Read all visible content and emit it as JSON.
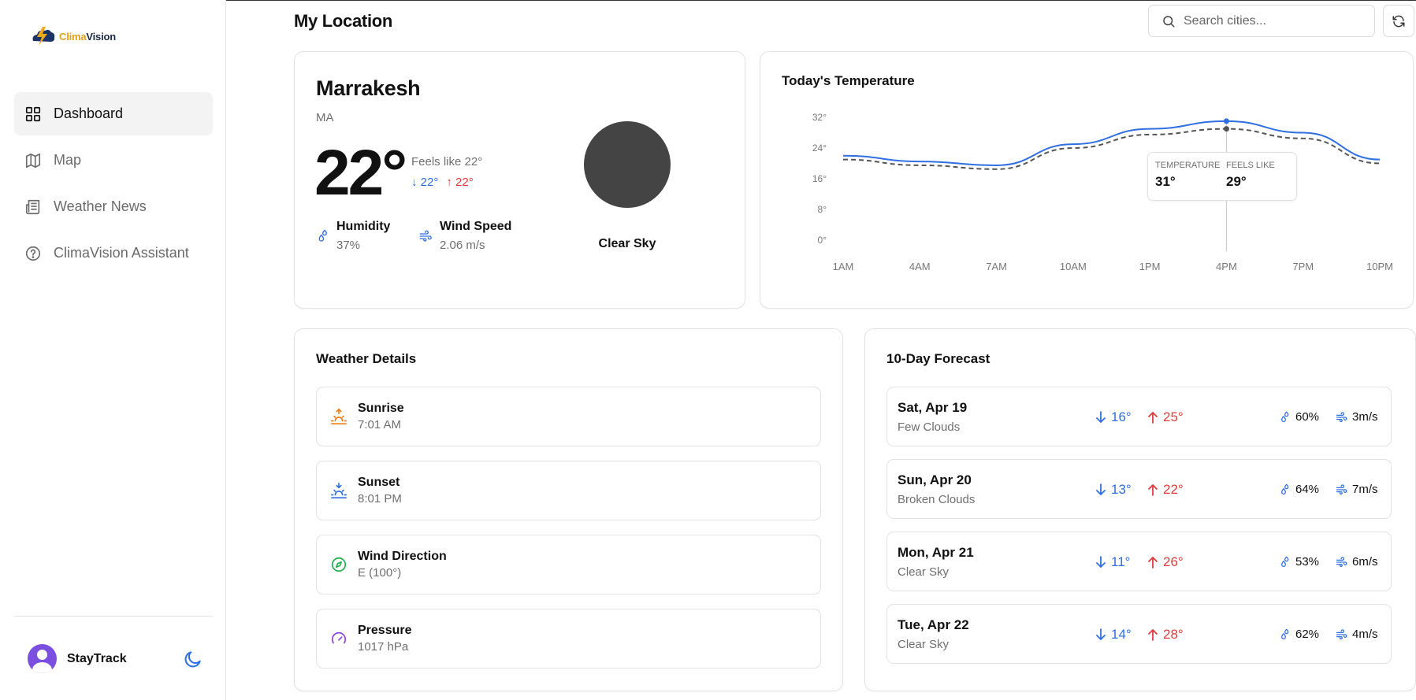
{
  "app": {
    "logo_prefix": "Clima",
    "logo_suffix": "Vision",
    "accent_color": "#2f6fe0",
    "max_color": "#e23b3b"
  },
  "sidebar": {
    "items": [
      {
        "label": "Dashboard",
        "icon": "grid-icon",
        "active": true
      },
      {
        "label": "Map",
        "icon": "map-icon",
        "active": false
      },
      {
        "label": "Weather News",
        "icon": "newspaper-icon",
        "active": false
      },
      {
        "label": "ClimaVision Assistant",
        "icon": "help-circle-icon",
        "active": false
      }
    ],
    "user_name": "StayTrack",
    "theme_icon": "moon-icon"
  },
  "header": {
    "title": "My Location",
    "search_placeholder": "Search cities..."
  },
  "current": {
    "city": "Marrakesh",
    "country": "MA",
    "temperature": "22°",
    "feels_like": "Feels like 22°",
    "min": "22°",
    "max": "22°",
    "humidity_label": "Humidity",
    "humidity_value": "37%",
    "wind_label": "Wind Speed",
    "wind_value": "2.06 m/s",
    "condition": "Clear Sky"
  },
  "temperature_chart": {
    "title": "Today's Temperature",
    "tooltip": {
      "temp_label": "Temperature",
      "temp_value": "31°",
      "feels_label": "Feels like",
      "feels_value": "29°"
    }
  },
  "chart_data": {
    "type": "line",
    "title": "Today's Temperature",
    "x": [
      "1AM",
      "4AM",
      "7AM",
      "10AM",
      "1PM",
      "4PM",
      "7PM",
      "10PM"
    ],
    "y_ticks": [
      "0°",
      "8°",
      "16°",
      "24°",
      "32°"
    ],
    "ylim": [
      0,
      32
    ],
    "series": [
      {
        "values": [
          22,
          20.5,
          19.5,
          25,
          29,
          31,
          28,
          21
        ]
      },
      {
        "values": [
          21,
          19.5,
          18.5,
          24,
          27.5,
          29,
          26.5,
          20
        ]
      }
    ],
    "colors": [
      "#2f6fe0",
      "#555555"
    ],
    "grid": false
  },
  "details": {
    "title": "Weather Details",
    "items": [
      {
        "label": "Sunrise",
        "value": "7:01 AM",
        "icon": "sunrise-icon"
      },
      {
        "label": "Sunset",
        "value": "8:01 PM",
        "icon": "sunset-icon"
      },
      {
        "label": "Wind Direction",
        "value": "E (100°)",
        "icon": "compass-icon"
      },
      {
        "label": "Pressure",
        "value": "1017 hPa",
        "icon": "gauge-icon"
      }
    ]
  },
  "forecast": {
    "title": "10-Day Forecast",
    "days": [
      {
        "day": "Sat, Apr 19",
        "desc": "Few Clouds",
        "min": "16°",
        "max": "25°",
        "humidity": "60%",
        "wind": "3m/s"
      },
      {
        "day": "Sun, Apr 20",
        "desc": "Broken Clouds",
        "min": "13°",
        "max": "22°",
        "humidity": "64%",
        "wind": "7m/s"
      },
      {
        "day": "Mon, Apr 21",
        "desc": "Clear Sky",
        "min": "11°",
        "max": "26°",
        "humidity": "53%",
        "wind": "6m/s"
      },
      {
        "day": "Tue, Apr 22",
        "desc": "Clear Sky",
        "min": "14°",
        "max": "28°",
        "humidity": "62%",
        "wind": "4m/s"
      }
    ]
  }
}
